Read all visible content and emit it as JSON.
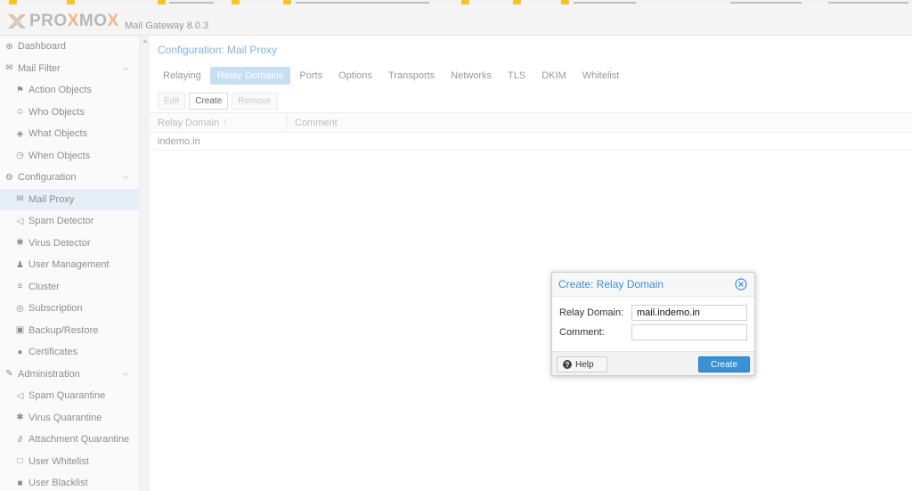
{
  "colors": {
    "accent": "#3892d4",
    "title_blue": "#3b8fd8",
    "active_tab_bg": "#c8def3",
    "active_nav_bg": "#e6eef7",
    "logo_orange": "#f2b48a"
  },
  "header": {
    "logo_text_left": "PRO",
    "logo_text_x": "X",
    "logo_text_mo": "MO",
    "logo_text_x2": "X",
    "product": "Mail Gateway 8.0.3"
  },
  "sidebar": {
    "items": [
      {
        "label": "Dashboard",
        "icon": "dashboard-icon",
        "glyph": "⊕"
      },
      {
        "label": "Mail Filter",
        "icon": "envelope-icon",
        "glyph": "✉"
      },
      {
        "label": "Action Objects",
        "icon": "flag-icon",
        "glyph": "⚑"
      },
      {
        "label": "Who Objects",
        "icon": "user-circle-icon",
        "glyph": "☺"
      },
      {
        "label": "What Objects",
        "icon": "cube-icon",
        "glyph": "◈"
      },
      {
        "label": "When Objects",
        "icon": "clock-icon",
        "glyph": "◷"
      },
      {
        "label": "Configuration",
        "icon": "cogs-icon",
        "glyph": "⚙"
      },
      {
        "label": "Mail Proxy",
        "icon": "envelope-outline-icon",
        "glyph": "✉"
      },
      {
        "label": "Spam Detector",
        "icon": "bullhorn-icon",
        "glyph": "◁"
      },
      {
        "label": "Virus Detector",
        "icon": "bug-icon",
        "glyph": "✱"
      },
      {
        "label": "User Management",
        "icon": "users-icon",
        "glyph": "♟"
      },
      {
        "label": "Cluster",
        "icon": "cluster-icon",
        "glyph": "≡"
      },
      {
        "label": "Subscription",
        "icon": "support-icon",
        "glyph": "◎"
      },
      {
        "label": "Backup/Restore",
        "icon": "floppy-icon",
        "glyph": "▣"
      },
      {
        "label": "Certificates",
        "icon": "certificate-icon",
        "glyph": "●"
      },
      {
        "label": "Administration",
        "icon": "wrench-icon",
        "glyph": "✎"
      },
      {
        "label": "Spam Quarantine",
        "icon": "bullhorn-icon",
        "glyph": "◁"
      },
      {
        "label": "Virus Quarantine",
        "icon": "bug-icon",
        "glyph": "✱"
      },
      {
        "label": "Attachment Quarantine",
        "icon": "paperclip-icon",
        "glyph": "∂"
      },
      {
        "label": "User Whitelist",
        "icon": "file-outline-icon",
        "glyph": "□"
      },
      {
        "label": "User Blacklist",
        "icon": "file-icon",
        "glyph": "■"
      }
    ]
  },
  "main": {
    "title": "Configuration: Mail Proxy",
    "tabs": [
      "Relaying",
      "Relay Domains",
      "Ports",
      "Options",
      "Transports",
      "Networks",
      "TLS",
      "DKIM",
      "Whitelist"
    ],
    "active_tab": "Relay Domains",
    "toolbar": {
      "edit": "Edit",
      "create": "Create",
      "remove": "Remove"
    },
    "columns": {
      "relay_domain": "Relay Domain",
      "sort_glyph": "↑",
      "comment": "Comment"
    },
    "rows": [
      {
        "relay_domain": "indemo.in",
        "comment": ""
      }
    ]
  },
  "dialog": {
    "title": "Create: Relay Domain",
    "relay_domain_label": "Relay Domain:",
    "relay_domain_value": "mail.indemo.in",
    "comment_label": "Comment:",
    "comment_value": "",
    "help_label": "Help",
    "create_label": "Create"
  }
}
